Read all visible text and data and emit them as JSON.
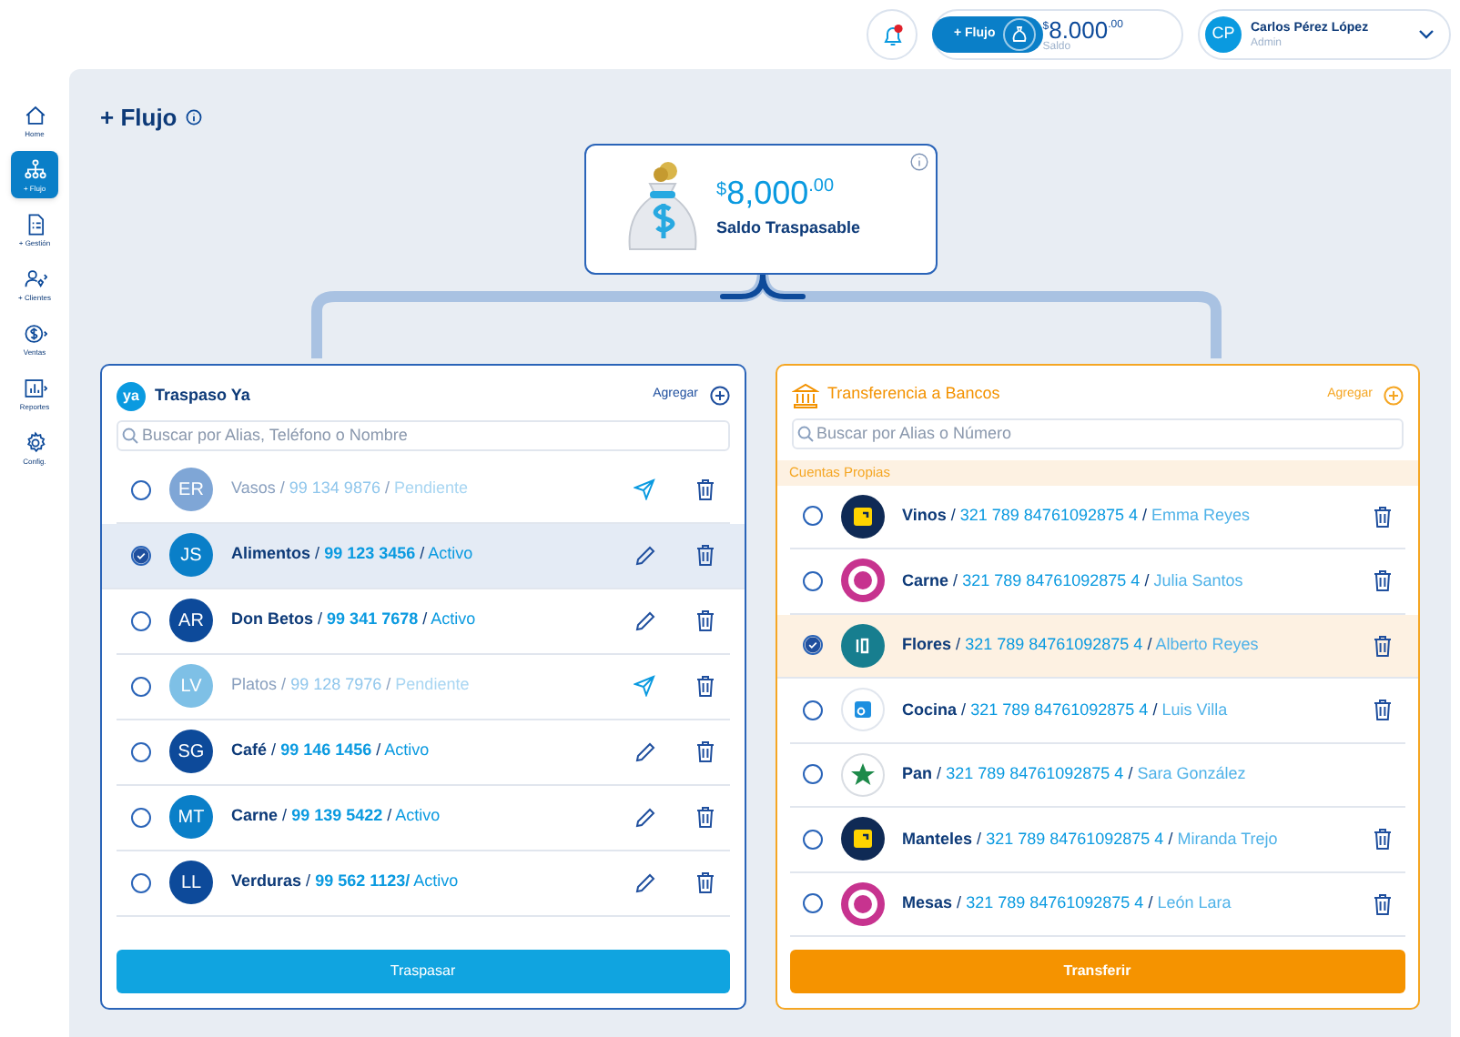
{
  "header": {
    "notifications": {
      "unread": true
    },
    "flow_button": "+ Flujo",
    "balance": {
      "currency": "$",
      "amount": "8.000",
      "cents": ".00",
      "label": "Saldo"
    },
    "user": {
      "initials": "CP",
      "name": "Carlos Pérez López",
      "role": "Admin"
    }
  },
  "sidebar": {
    "items": [
      {
        "label": "Home",
        "selected": false
      },
      {
        "label": "+ Flujo",
        "selected": true
      },
      {
        "label": "+ Gestión",
        "selected": false
      },
      {
        "label": "+ Clientes",
        "selected": false
      },
      {
        "label": "Ventas",
        "selected": false
      },
      {
        "label": "Reportes",
        "selected": false
      },
      {
        "label": "Config.",
        "selected": false
      }
    ]
  },
  "page_title": "+ Flujo",
  "balance_card": {
    "currency": "$",
    "amount": "8,000",
    "cents": ".00",
    "label": "Saldo Traspasable"
  },
  "traspaso": {
    "logo": "ya",
    "title": "Traspaso Ya",
    "add_label": "Agregar",
    "search_placeholder": "Buscar por Alias, Teléfono o Nombre",
    "button": "Traspasar",
    "contacts": [
      {
        "initials": "ER",
        "color": "#7fa6d6",
        "kind": "pending",
        "selected": false,
        "parts": [
          {
            "kind": "alias",
            "text": "Vasos"
          },
          {
            "kind": "sep",
            "text": "/"
          },
          {
            "kind": "number",
            "text": "99 134 9876"
          },
          {
            "kind": "sep",
            "text": "/"
          },
          {
            "kind": "status",
            "text": "Pendiente"
          }
        ]
      },
      {
        "initials": "JS",
        "color": "#0a7fc8",
        "kind": "active",
        "selected": true,
        "parts": [
          {
            "kind": "alias",
            "text": "Alimentos"
          },
          {
            "kind": "sep",
            "text": "/"
          },
          {
            "kind": "number",
            "text": "99 123 3456"
          },
          {
            "kind": "sep",
            "text": "/"
          },
          {
            "kind": "status",
            "text": "Activo"
          }
        ]
      },
      {
        "initials": "AR",
        "color": "#0d4a9a",
        "kind": "active",
        "selected": false,
        "parts": [
          {
            "kind": "alias",
            "text": "Don Betos"
          },
          {
            "kind": "sep",
            "text": "/"
          },
          {
            "kind": "number",
            "text": "99 341 7678"
          },
          {
            "kind": "sep",
            "text": "/"
          },
          {
            "kind": "status",
            "text": "Activo"
          }
        ]
      },
      {
        "initials": "LV",
        "color": "#7ec0e6",
        "kind": "pending",
        "selected": false,
        "parts": [
          {
            "kind": "alias",
            "text": "Platos"
          },
          {
            "kind": "sep",
            "text": "/"
          },
          {
            "kind": "number",
            "text": "99 128 7976"
          },
          {
            "kind": "sep",
            "text": "/"
          },
          {
            "kind": "status",
            "text": "Pendiente"
          }
        ]
      },
      {
        "initials": "SG",
        "color": "#0d4a9a",
        "kind": "active",
        "selected": false,
        "parts": [
          {
            "kind": "alias",
            "text": "Café"
          },
          {
            "kind": "sep",
            "text": "/"
          },
          {
            "kind": "number",
            "text": "99 146 1456"
          },
          {
            "kind": "sep",
            "text": "/"
          },
          {
            "kind": "status",
            "text": "Activo"
          }
        ]
      },
      {
        "initials": "MT",
        "color": "#0a7fc8",
        "kind": "active",
        "selected": false,
        "parts": [
          {
            "kind": "alias",
            "text": "Carne"
          },
          {
            "kind": "sep",
            "text": "/"
          },
          {
            "kind": "number",
            "text": "99 139 5422"
          },
          {
            "kind": "sep",
            "text": "/"
          },
          {
            "kind": "status",
            "text": "Activo"
          }
        ]
      },
      {
        "initials": "LL",
        "color": "#0d4a9a",
        "kind": "active",
        "selected": false,
        "parts": [
          {
            "kind": "alias",
            "text": "Verduras"
          },
          {
            "kind": "sep",
            "text": "/"
          },
          {
            "kind": "number",
            "text": "99 562 1123/"
          },
          {
            "kind": "status",
            "text": "Activo"
          }
        ]
      }
    ]
  },
  "bancos": {
    "title": "Transferencia a Bancos",
    "add_label": "Agregar",
    "search_placeholder": "Buscar por Alias o Número",
    "section": "Cuentas Propias",
    "button": "Transferir",
    "accounts": [
      {
        "kind": "square",
        "deletable": true,
        "selected": false,
        "parts": [
          {
            "kind": "alias",
            "text": "Vinos"
          },
          {
            "kind": "sep",
            "text": "/"
          },
          {
            "kind": "number",
            "text": "321 789 84761092875 4"
          },
          {
            "kind": "sep",
            "text": "/"
          },
          {
            "kind": "owner",
            "text": "Emma Reyes"
          }
        ]
      },
      {
        "kind": "ring",
        "deletable": true,
        "selected": false,
        "parts": [
          {
            "kind": "alias",
            "text": "Carne"
          },
          {
            "kind": "sep",
            "text": "/"
          },
          {
            "kind": "number",
            "text": "321 789 84761092875 4"
          },
          {
            "kind": "sep",
            "text": "/"
          },
          {
            "kind": "owner",
            "text": "Julia Santos"
          }
        ]
      },
      {
        "kind": "teal",
        "deletable": true,
        "selected": true,
        "parts": [
          {
            "kind": "alias",
            "text": "Flores"
          },
          {
            "kind": "sep",
            "text": "/"
          },
          {
            "kind": "number",
            "text": "321 789 84761092875 4"
          },
          {
            "kind": "sep",
            "text": "/"
          },
          {
            "kind": "owner",
            "text": "Alberto Reyes"
          }
        ]
      },
      {
        "kind": "blue",
        "deletable": true,
        "selected": false,
        "parts": [
          {
            "kind": "alias",
            "text": "Cocina"
          },
          {
            "kind": "sep",
            "text": "/"
          },
          {
            "kind": "number",
            "text": "321 789 84761092875 4"
          },
          {
            "kind": "sep",
            "text": "/"
          },
          {
            "kind": "owner",
            "text": "Luis Villa"
          }
        ]
      },
      {
        "kind": "star",
        "deletable": false,
        "selected": false,
        "parts": [
          {
            "kind": "alias",
            "text": "Pan"
          },
          {
            "kind": "sep",
            "text": "/"
          },
          {
            "kind": "number",
            "text": "321 789 84761092875 4"
          },
          {
            "kind": "sep",
            "text": "/"
          },
          {
            "kind": "owner",
            "text": "Sara González"
          }
        ]
      },
      {
        "kind": "square",
        "deletable": true,
        "selected": false,
        "parts": [
          {
            "kind": "alias",
            "text": "Manteles"
          },
          {
            "kind": "sep",
            "text": "/"
          },
          {
            "kind": "number",
            "text": "321 789 84761092875 4"
          },
          {
            "kind": "sep",
            "text": "/"
          },
          {
            "kind": "owner",
            "text": "Miranda Trejo"
          }
        ]
      },
      {
        "kind": "ring",
        "deletable": true,
        "selected": false,
        "parts": [
          {
            "kind": "alias",
            "text": "Mesas"
          },
          {
            "kind": "sep",
            "text": "/"
          },
          {
            "kind": "number",
            "text": "321 789 84761092875 4"
          },
          {
            "kind": "sep",
            "text": "/"
          },
          {
            "kind": "owner",
            "text": "León Lara"
          }
        ]
      }
    ]
  }
}
